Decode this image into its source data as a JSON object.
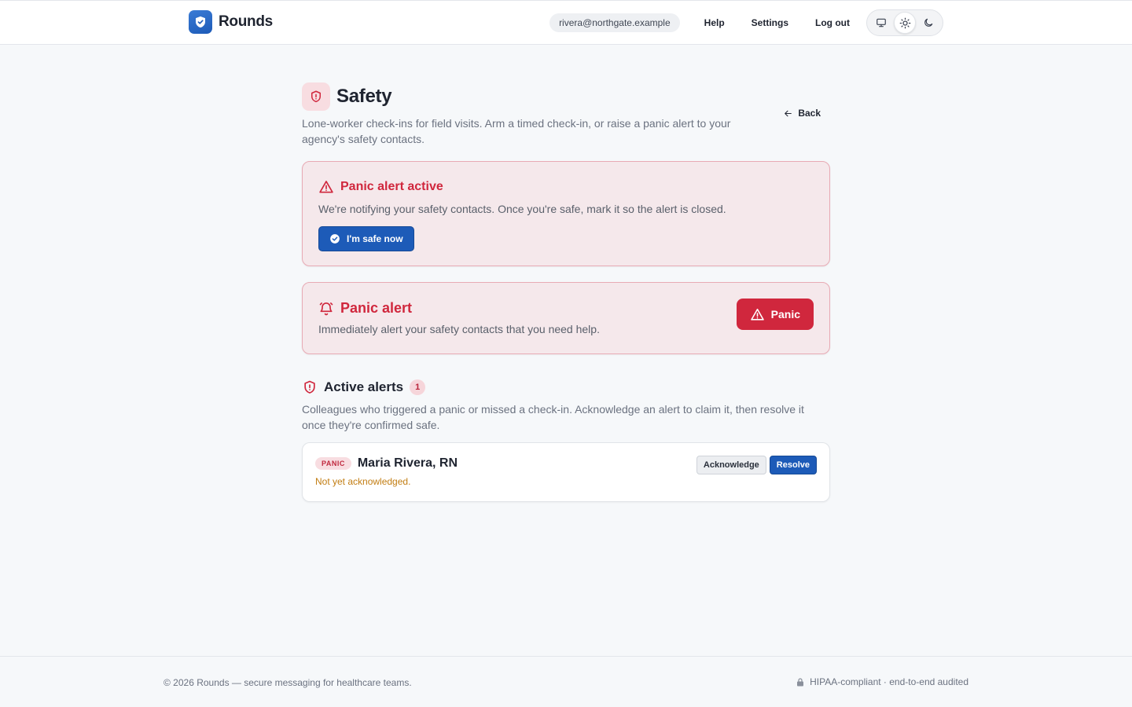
{
  "header": {
    "brand": "Rounds",
    "email": "rivera@northgate.example",
    "nav": [
      "Help",
      "Settings",
      "Log out"
    ],
    "theme_options": [
      "monitor-icon",
      "sun-icon",
      "moon-icon"
    ],
    "theme_selected": "light"
  },
  "page": {
    "title": "Safety",
    "description": "Lone-worker check-ins for field visits. Arm a timed check-in, or raise a panic alert to your agency's safety contacts.",
    "back_label": "Back"
  },
  "active_alert": {
    "title": "Panic alert active",
    "text": "We're notifying your safety contacts. Once you're safe, mark it so the alert is closed.",
    "button_label": "I'm safe now"
  },
  "panic": {
    "title": "Panic alert",
    "text": "Immediately alert your safety contacts that you need help.",
    "button_label": "Panic"
  },
  "alerts_section": {
    "title": "Active alerts",
    "count": "1",
    "description": "Colleagues who triggered a panic or missed a check-in. Acknowledge an alert to claim it, then resolve it once they're confirmed safe.",
    "items": [
      {
        "type": "PANIC",
        "name": "Maria Rivera, RN",
        "status": "Not yet acknowledged.",
        "acknowledge_label": "Acknowledge",
        "resolve_label": "Resolve"
      }
    ]
  },
  "footer": {
    "left": "© 2026 Rounds — secure messaging for healthcare teams.",
    "right": "HIPAA-compliant · end-to-end audited"
  },
  "colors": {
    "accent": "#1d5bb8",
    "danger": "#d0273d",
    "warning_text": "#c27d12"
  }
}
